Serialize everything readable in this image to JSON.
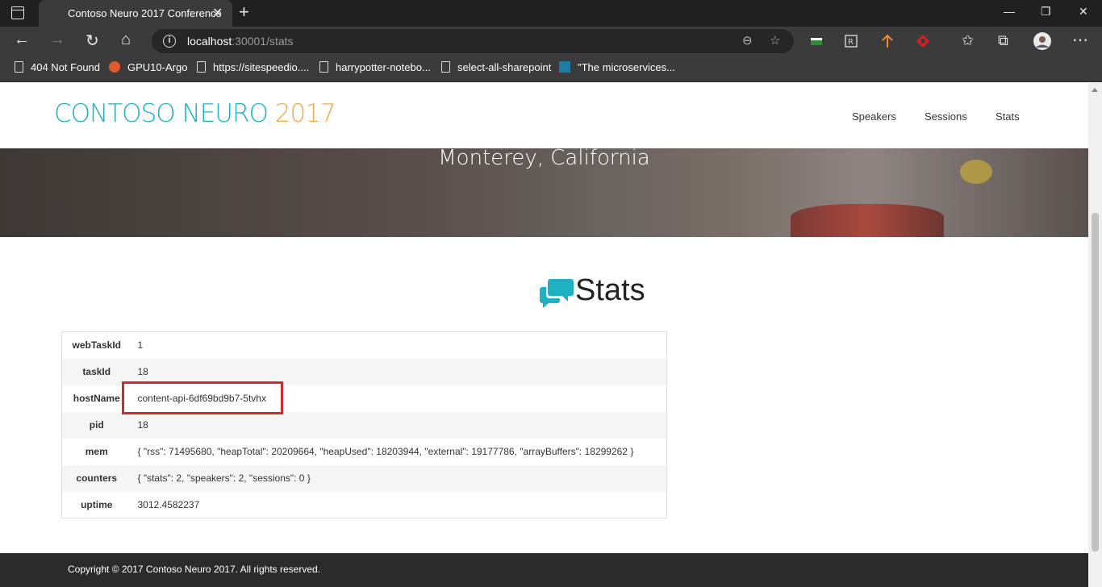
{
  "browser": {
    "tab_title": "Contoso Neuro 2017 Conference",
    "tab_close": "✕",
    "new_tab": "+",
    "url_host": "localhost",
    "url_path": ":30001/stats",
    "bookmarks": [
      {
        "label": "404 Not Found",
        "icon": "document-icon"
      },
      {
        "label": "GPU10-Argo",
        "icon": "argo-icon"
      },
      {
        "label": "https://sitespeedio....",
        "icon": "document-icon"
      },
      {
        "label": "harrypotter-notebo...",
        "icon": "document-icon"
      },
      {
        "label": "select-all-sharepoint",
        "icon": "document-icon"
      },
      {
        "label": "\"The microservices...",
        "icon": "forms-icon"
      }
    ]
  },
  "site": {
    "logo_main": "CONTOSO NEURO ",
    "logo_year": "2017",
    "nav": [
      "Speakers",
      "Sessions",
      "Stats"
    ],
    "hero_location": "Monterey, California",
    "colors": {
      "accent": "#1fb0c4",
      "year": "#f2a94b",
      "footer": "#2b2b2b",
      "highlight": "#d12a2a"
    }
  },
  "stats": {
    "title": "Stats",
    "rows": [
      {
        "key": "webTaskId",
        "value": "1"
      },
      {
        "key": "taskId",
        "value": "18"
      },
      {
        "key": "hostName",
        "value": "content-api-6df69bd9b7-5tvhx"
      },
      {
        "key": "pid",
        "value": "18"
      },
      {
        "key": "mem",
        "value": "{ \"rss\": 71495680, \"heapTotal\": 20209664, \"heapUsed\": 18203944, \"external\": 19177786, \"arrayBuffers\": 18299262 }"
      },
      {
        "key": "counters",
        "value": "{ \"stats\": 2, \"speakers\": 2, \"sessions\": 0 }"
      },
      {
        "key": "uptime",
        "value": "3012.4582237"
      }
    ]
  },
  "footer": {
    "copyright": "Copyright © 2017 Contoso Neuro 2017. All rights reserved."
  }
}
